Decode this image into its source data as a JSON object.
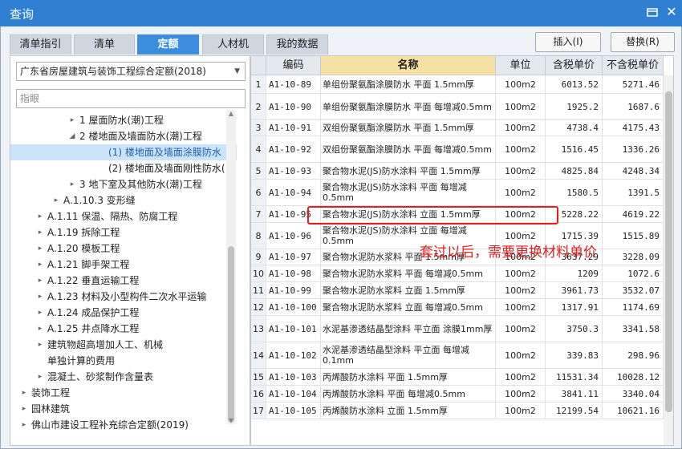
{
  "window": {
    "title": "查询"
  },
  "tabs": [
    {
      "label": "清单指引",
      "active": false
    },
    {
      "label": "清单",
      "active": false
    },
    {
      "label": "定额",
      "active": true
    },
    {
      "label": "人材机",
      "active": false
    },
    {
      "label": "我的数据",
      "active": false
    }
  ],
  "buttons": {
    "insert": "插入(I)",
    "replace": "替换(R)"
  },
  "library": {
    "selected": "广东省房屋建筑与装饰工程综合定额(2018)"
  },
  "filter": {
    "placeholder": "指眼"
  },
  "tree": [
    {
      "label": "1 屋面防水(潮)工程",
      "indent": 86,
      "toggle": "▸",
      "selected": false
    },
    {
      "label": "2 楼地面及墙面防水(潮)工程",
      "indent": 86,
      "toggle": "◢",
      "selected": false
    },
    {
      "label": "(1) 楼地面及墙面涂膜防水",
      "indent": 122,
      "toggle": "",
      "selected": true
    },
    {
      "label": "(2) 楼地面及墙面刚性防水(…",
      "indent": 122,
      "toggle": "",
      "selected": false
    },
    {
      "label": "3 地下室及其他防水(潮)工程",
      "indent": 86,
      "toggle": "▸",
      "selected": false
    },
    {
      "label": "A.1.10.3 变形缝",
      "indent": 66,
      "toggle": "▸",
      "selected": false
    },
    {
      "label": "A.1.11 保温、隔热、防腐工程",
      "indent": 46,
      "toggle": "▸",
      "selected": false
    },
    {
      "label": "A.1.19 拆除工程",
      "indent": 46,
      "toggle": "▸",
      "selected": false
    },
    {
      "label": "A.1.20 模板工程",
      "indent": 46,
      "toggle": "▸",
      "selected": false
    },
    {
      "label": "A.1.21 脚手架工程",
      "indent": 46,
      "toggle": "▸",
      "selected": false
    },
    {
      "label": "A.1.22 垂直运输工程",
      "indent": 46,
      "toggle": "▸",
      "selected": false
    },
    {
      "label": "A.1.23 材料及小型构件二次水平运输",
      "indent": 46,
      "toggle": "▸",
      "selected": false
    },
    {
      "label": "A.1.24 成品保护工程",
      "indent": 46,
      "toggle": "▸",
      "selected": false
    },
    {
      "label": "A.1.25 井点降水工程",
      "indent": 46,
      "toggle": "▸",
      "selected": false
    },
    {
      "label": "建筑物超高增加人工、机械",
      "indent": 46,
      "toggle": "▸",
      "selected": false
    },
    {
      "label": "单独计算的费用",
      "indent": 46,
      "toggle": "",
      "selected": false
    },
    {
      "label": "混凝土、砂浆制作含量表",
      "indent": 46,
      "toggle": "▸",
      "selected": false
    },
    {
      "label": "装饰工程",
      "indent": 26,
      "toggle": "▸",
      "selected": false
    },
    {
      "label": "园林建筑",
      "indent": 26,
      "toggle": "▸",
      "selected": false
    },
    {
      "label": "佛山市建设工程补充综合定额(2019)",
      "indent": 26,
      "toggle": "▸",
      "selected": false
    }
  ],
  "grid": {
    "headers": {
      "no": "",
      "code": "编码",
      "name": "名称",
      "unit": "单位",
      "tax": "含税单价",
      "notax": "不含税单价"
    },
    "rows": [
      {
        "no": "1",
        "code": "A1-10-89",
        "name": "单组份聚氨酯涂膜防水 平面 1.5mm厚",
        "unit": "100m2",
        "tax": "6013.52",
        "notax": "5271.46",
        "h": 23
      },
      {
        "no": "2",
        "code": "A1-10-90",
        "name": "单组份聚氨酯涂膜防水 平面 每增减0.5mm",
        "unit": "100m2",
        "tax": "1925.2",
        "notax": "1687.6",
        "h": 33
      },
      {
        "no": "3",
        "code": "A1-10-91",
        "name": "双组份聚氨酯涂膜防水 平面 1.5mm厚",
        "unit": "100m2",
        "tax": "4738.4",
        "notax": "4175.43",
        "h": 20
      },
      {
        "no": "4",
        "code": "A1-10-92",
        "name": "双组份聚氨酯涂膜防水 平面 每增减0.5mm",
        "unit": "100m2",
        "tax": "1516.45",
        "notax": "1336.26",
        "h": 33
      },
      {
        "no": "5",
        "code": "A1-10-93",
        "name": "聚合物水泥(JS)防水涂料 平面 1.5mm厚",
        "unit": "100m2",
        "tax": "4825.84",
        "notax": "4248.34",
        "h": 21
      },
      {
        "no": "6",
        "code": "A1-10-94",
        "name": "聚合物水泥(JS)防水涂料 平面 每增减0.5mm",
        "unit": "100m2",
        "tax": "1580.5",
        "notax": "1391.5",
        "h": 33
      },
      {
        "no": "7",
        "code": "A1-10-95",
        "name": "聚合物水泥(JS)防水涂料 立面 1.5mm厚",
        "unit": "100m2",
        "tax": "5228.22",
        "notax": "4619.22",
        "h": 21
      },
      {
        "no": "8",
        "code": "A1-10-96",
        "name": "聚合物水泥(JS)防水涂料 立面 每增减0.5mm",
        "unit": "100m2",
        "tax": "1715.39",
        "notax": "1515.89",
        "h": 33
      },
      {
        "no": "9",
        "code": "A1-10-97",
        "name": "聚合物水泥防水浆料 平面 1.5mm厚",
        "unit": "100m2",
        "tax": "3637.29",
        "notax": "3228.09",
        "h": 20
      },
      {
        "no": "10",
        "code": "A1-10-98",
        "name": "聚合物水泥防水浆料 平面 每增减0.5mm",
        "unit": "100m2",
        "tax": "1209",
        "notax": "1072.6",
        "h": 21
      },
      {
        "no": "11",
        "code": "A1-10-99",
        "name": "聚合物水泥防水浆料 立面 1.5mm厚",
        "unit": "100m2",
        "tax": "3961.73",
        "notax": "3532.07",
        "h": 21
      },
      {
        "no": "12",
        "code": "A1-10-100",
        "name": "聚合物水泥防水浆料 立面 每增减0.5mm",
        "unit": "100m2",
        "tax": "1317.91",
        "notax": "1174.69",
        "h": 21
      },
      {
        "no": "13",
        "code": "A1-10-101",
        "name": "水泥基渗透结晶型涂料 平立面 涂膜1mm厚",
        "unit": "100m2",
        "tax": "3750.3",
        "notax": "3341.58",
        "h": 33
      },
      {
        "no": "14",
        "code": "A1-10-102",
        "name": "水泥基渗透结晶型涂料 平立面 每增减0.1mm",
        "unit": "100m2",
        "tax": "339.83",
        "notax": "298.96",
        "h": 33
      },
      {
        "no": "15",
        "code": "A1-10-103",
        "name": "丙烯酸防水涂料 平面 1.5mm厚",
        "unit": "100m2",
        "tax": "11531.34",
        "notax": "10028.12",
        "h": 21
      },
      {
        "no": "16",
        "code": "A1-10-104",
        "name": "丙烯酸防水涂料 平面 每增减0.5mm",
        "unit": "100m2",
        "tax": "3841.11",
        "notax": "3340.04",
        "h": 21
      },
      {
        "no": "17",
        "code": "A1-10-105",
        "name": "丙烯酸防水涂料 立面 1.5mm厚",
        "unit": "100m2",
        "tax": "12199.54",
        "notax": "10621.16",
        "h": 21
      }
    ]
  },
  "annotation": {
    "text": "套过以后，需要更换材料单价",
    "color": "#e02020"
  },
  "colors": {
    "titlebar": "#2f7fd3",
    "active_tab": "#3b8de0",
    "name_header": "#f6e1a2"
  }
}
